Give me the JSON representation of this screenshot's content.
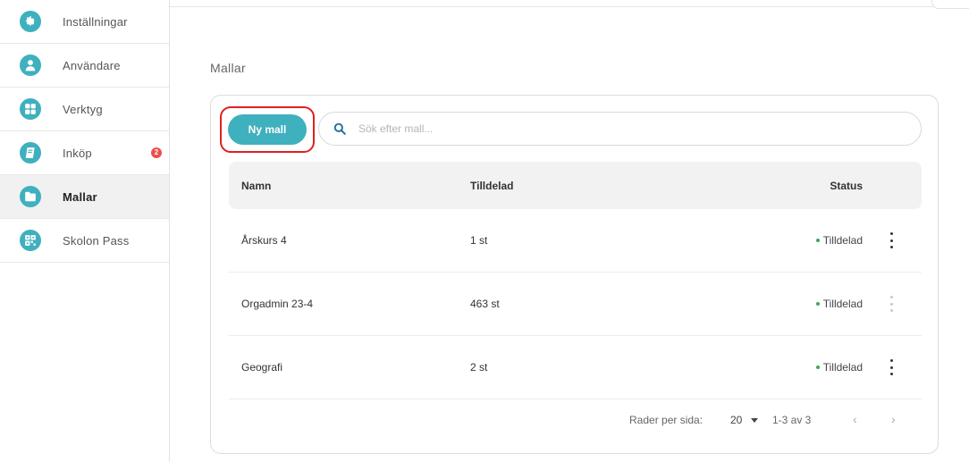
{
  "sidebar": {
    "items": [
      {
        "label": "Inställningar",
        "icon": "gear-icon"
      },
      {
        "label": "Användare",
        "icon": "user-icon"
      },
      {
        "label": "Verktyg",
        "icon": "tools-grid-icon"
      },
      {
        "label": "Inköp",
        "icon": "book-icon",
        "badge": "2"
      },
      {
        "label": "Mallar",
        "icon": "folder-icon",
        "active": true
      },
      {
        "label": "Skolon Pass",
        "icon": "qr-code-icon"
      }
    ]
  },
  "page": {
    "title": "Mallar"
  },
  "toolbar": {
    "new_button": "Ny mall",
    "search_placeholder": "Sök efter mall..."
  },
  "table": {
    "headers": {
      "name": "Namn",
      "tilldelad": "Tilldelad",
      "status": "Status"
    },
    "rows": [
      {
        "name": "Årskurs 4",
        "tilldelad": "1 st",
        "status": "Tilldelad"
      },
      {
        "name": "Orgadmin 23-4",
        "tilldelad": "463 st",
        "status": "Tilldelad"
      },
      {
        "name": "Geografi",
        "tilldelad": "2 st",
        "status": "Tilldelad"
      }
    ]
  },
  "pagination": {
    "rows_per_page_label": "Rader per sida:",
    "rows_per_page": "20",
    "range": "1-3 av 3",
    "prev": "‹",
    "next": "›"
  },
  "colors": {
    "accent": "#3fb0be",
    "highlight": "#e02020",
    "status_ok": "#3aa85a",
    "badge": "#e8524a"
  }
}
